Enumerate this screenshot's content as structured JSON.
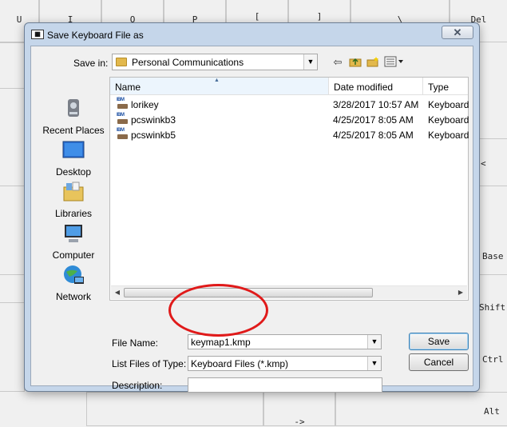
{
  "background_keys": [
    "U",
    "I",
    "O",
    "P",
    "[",
    "]",
    "\\",
    "Del"
  ],
  "background_side": [
    "<",
    "Base",
    "Shift",
    "Ctrl",
    "Alt"
  ],
  "background_arrow": "->",
  "dialog": {
    "title": "Save Keyboard File as",
    "close_glyph": "✕",
    "save_in": {
      "label": "Save in:",
      "value": "Personal Communications"
    },
    "places": [
      {
        "label": "Recent Places",
        "icon": "recent-places-icon"
      },
      {
        "label": "Desktop",
        "icon": "desktop-icon"
      },
      {
        "label": "Libraries",
        "icon": "libraries-icon"
      },
      {
        "label": "Computer",
        "icon": "computer-icon"
      },
      {
        "label": "Network",
        "icon": "network-icon"
      }
    ],
    "columns": [
      "Name",
      "Date modified",
      "Type"
    ],
    "files": [
      {
        "name": "lorikey",
        "date": "3/28/2017 10:57 AM",
        "type": "Keyboard"
      },
      {
        "name": "pcswinkb3",
        "date": "4/25/2017 8:05 AM",
        "type": "Keyboard"
      },
      {
        "name": "pcswinkb5",
        "date": "4/25/2017 8:05 AM",
        "type": "Keyboard"
      }
    ],
    "file_name": {
      "label": "File Name:",
      "value": "keymap1.kmp"
    },
    "file_type": {
      "label": "List Files of Type:",
      "value": "Keyboard Files (*.kmp)"
    },
    "description": {
      "label": "Description:",
      "value": ""
    },
    "buttons": {
      "save": "Save",
      "cancel": "Cancel"
    }
  },
  "colors": {
    "annotation": "#e01a1a",
    "title_bar": "#c5d6ea"
  }
}
